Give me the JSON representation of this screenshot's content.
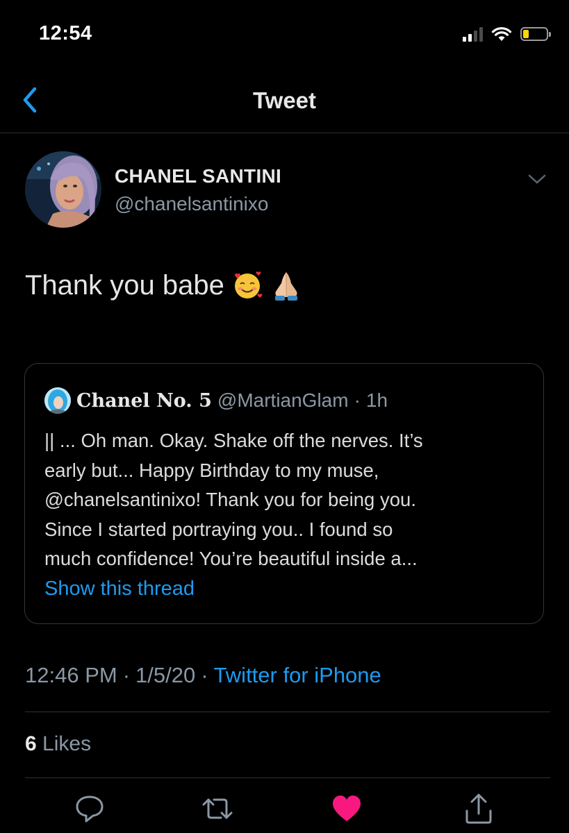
{
  "status_bar": {
    "time": "12:54",
    "battery_level": 0.25,
    "battery_color": "#ffd60a"
  },
  "nav": {
    "title": "Tweet",
    "back_icon": "chevron-left-icon"
  },
  "tweet": {
    "author_name": "CHANEL SANTINI",
    "author_handle": "@chanelsantinixo",
    "text": "Thank you babe",
    "emojis": [
      "smiling-face-with-hearts-icon",
      "folded-hands-icon"
    ],
    "timestamp": "12:46 PM",
    "date": "1/5/20",
    "separator": "·",
    "source": "Twitter for iPhone",
    "likes_count": "6",
    "likes_label": "Likes"
  },
  "quote": {
    "name": "Chanel No. 5",
    "handle": "@MartianGlam",
    "separator": "·",
    "time": "1h",
    "lines": [
      "|| ... Oh man. Okay. Shake off the nerves. It’s",
      "early but... Happy Birthday to my muse,",
      "@chanelsantinixo! Thank you for being you.",
      "Since I started portraying you.. I found so",
      "much confidence! You’re beautiful inside a..."
    ],
    "show_thread": "Show this thread"
  },
  "colors": {
    "accent": "#1d9bf0",
    "like": "#f91880",
    "secondary_text": "#8b98a5"
  },
  "actions": [
    "reply-icon",
    "retweet-icon",
    "like-icon",
    "share-icon"
  ]
}
